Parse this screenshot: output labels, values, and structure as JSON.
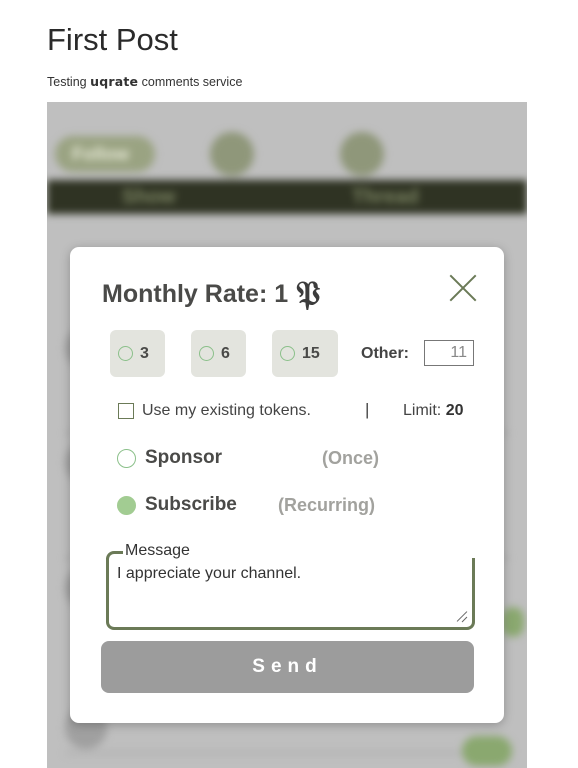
{
  "page": {
    "title": "First Post",
    "subtitle_prefix": "Testing ",
    "subtitle_brand": "uqrate",
    "subtitle_suffix": " comments service"
  },
  "background_widget": {
    "blurred_labels": [
      "Follow",
      "Show",
      "Thread"
    ]
  },
  "modal": {
    "title": "Monthly Rate: 1",
    "rate_glyph": "𝔓",
    "close_icon": "close-icon",
    "amounts": [
      {
        "label": "3"
      },
      {
        "label": "6"
      },
      {
        "label": "15"
      }
    ],
    "other_label": "Other:",
    "other_value": "11",
    "tokens_label": "Use my existing tokens.",
    "separator": "|",
    "limit_label": "Limit:",
    "limit_value": "20",
    "options": [
      {
        "label": "Sponsor",
        "note": "(Once)",
        "selected": false
      },
      {
        "label": "Subscribe",
        "note": "(Recurring)",
        "selected": true
      }
    ],
    "message_label": "Message",
    "message_value": "I appreciate your channel.",
    "send_label": "Send"
  },
  "colors": {
    "accent_green": "#6b7a57",
    "radio_green": "#a2cc92",
    "send_bg": "#9c9c9c"
  }
}
